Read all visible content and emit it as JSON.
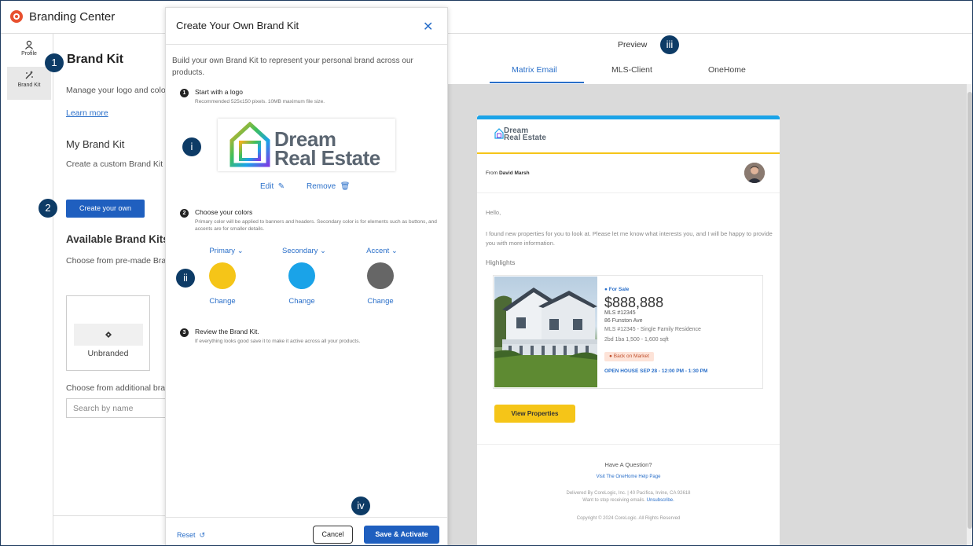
{
  "app": {
    "title": "Branding Center"
  },
  "nav": [
    {
      "label": "Profile",
      "icon": "person-icon"
    },
    {
      "label": "Brand Kit",
      "icon": "magic-wand-icon"
    }
  ],
  "left": {
    "heading": "Brand Kit",
    "description": "Manage your logo and colors for your real estate apps.",
    "learn_more": "Learn more",
    "my_kit_heading": "My Brand Kit",
    "my_kit_desc": "Create a custom Brand Kit for your personal brand.",
    "create_button": "Create your own",
    "available_heading": "Available Brand Kits",
    "available_desc": "Choose from pre-made Brand Kits or more brands.",
    "unbranded_label": "Unbranded",
    "additional_label": "Choose from additional brands",
    "search_placeholder": "Search by name"
  },
  "modal": {
    "title": "Create Your Own Brand Kit",
    "intro": "Build your own Brand Kit to represent your personal brand across our products.",
    "step1_title": "Start with a logo",
    "step1_desc": "Recommended 525x150 pixels. 10MB maximum file size.",
    "logo_line1": "Dream",
    "logo_line2": "Real Estate",
    "edit_label": "Edit",
    "remove_label": "Remove",
    "step2_title": "Choose your colors",
    "step2_desc": "Primary color will be applied to banners and headers. Secondary color is for elements such as buttons, and accents are for smaller details.",
    "colors": [
      {
        "label": "Primary",
        "hex": "#f5c518"
      },
      {
        "label": "Secondary",
        "hex": "#1aa3e8"
      },
      {
        "label": "Accent",
        "hex": "#666666"
      }
    ],
    "change_label": "Change",
    "step3_title": "Review the Brand Kit.",
    "step3_desc": "If everything looks good save it to make it active across all your products.",
    "reset": "Reset",
    "cancel": "Cancel",
    "save": "Save & Activate"
  },
  "callouts": [
    "1",
    "2",
    "i",
    "ii",
    "iii",
    "iv"
  ],
  "preview": {
    "title": "Preview",
    "tabs": [
      "Matrix Email",
      "MLS-Client",
      "OneHome"
    ],
    "email": {
      "logo_line1": "Dream",
      "logo_line2": "Real Estate",
      "from_prefix": "From",
      "from_name": "David Marsh",
      "hello": "Hello,",
      "body": "I found new properties for you to look at. Please let me know what interests you, and I will be happy to provide you with more information.",
      "highlights": "Highlights",
      "status": "For Sale",
      "price": "$888,888",
      "mls": "MLS #12345",
      "address": "86 Funston Ave",
      "type": "MLS #12345 - Single Family Residence",
      "specs": "2bd   1ba   1,500 - 1,600 sqft",
      "badge": "Back on Market",
      "open_house": "OPEN HOUSE SEP 28 - 12:00 PM - 1:30 PM",
      "view_button": "View Properties",
      "question": "Have A Question?",
      "help_link": "Visit The OneHome Help Page",
      "delivered": "Delivered By CoreLogic, Inc. | 40 Pacifica, Irvine, CA 92618",
      "unsubscribe_prefix": "Want to stop receiving emails.",
      "unsubscribe": "Unsubscribe.",
      "copyright": "Copyright © 2024 CoreLogic. All Rights Reserved"
    }
  }
}
